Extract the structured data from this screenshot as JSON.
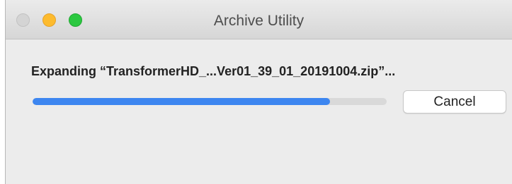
{
  "window": {
    "title": "Archive Utility"
  },
  "traffic_lights": {
    "close_color": "#d4d4d4",
    "minimize_color": "#fdbb2e",
    "zoom_color": "#2bc840"
  },
  "status": {
    "text": "Expanding “TransformerHD_...Ver01_39_01_20191004.zip”..."
  },
  "progress": {
    "fraction": 0.84,
    "fill_color": "#3d86f0"
  },
  "actions": {
    "cancel_label": "Cancel"
  }
}
